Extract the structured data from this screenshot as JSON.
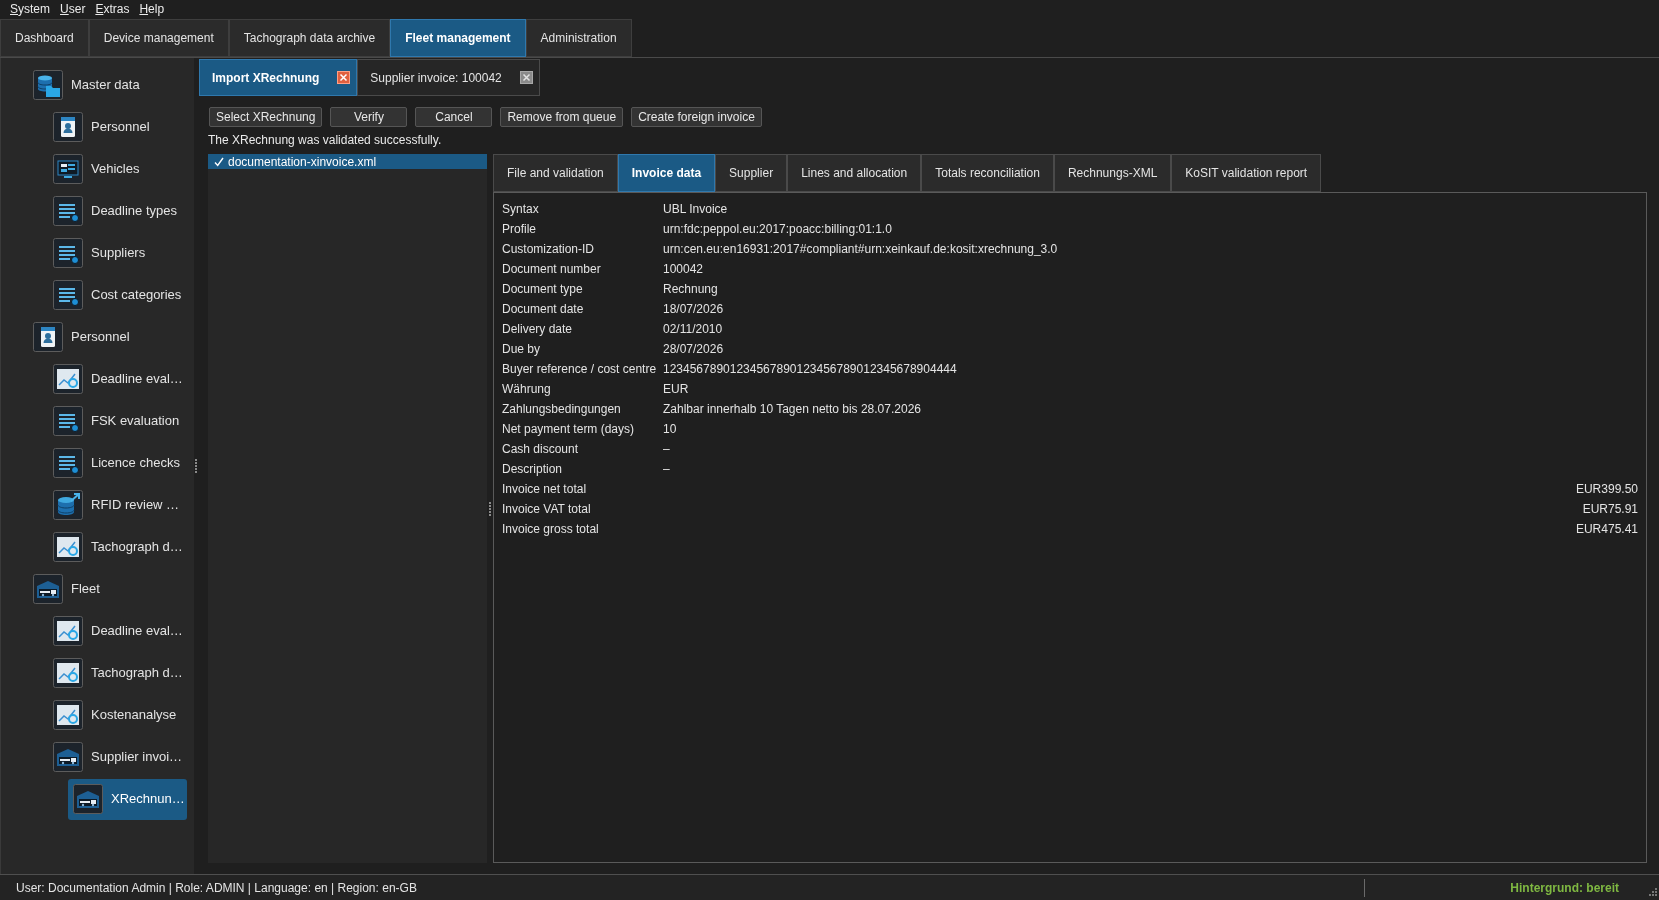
{
  "menu_bar": [
    {
      "label": "System",
      "mnemonic": true
    },
    {
      "label": "User",
      "mnemonic": true
    },
    {
      "label": "Extras",
      "mnemonic": true
    },
    {
      "label": "Help",
      "mnemonic": true
    }
  ],
  "main_tabs": [
    {
      "label": "Dashboard",
      "selected": false
    },
    {
      "label": "Device management",
      "selected": false
    },
    {
      "label": "Tachograph data archive",
      "selected": false
    },
    {
      "label": "Fleet management",
      "selected": true
    },
    {
      "label": "Administration",
      "selected": false
    }
  ],
  "sidebar": {
    "items": [
      {
        "label": "Master data",
        "kind": "database",
        "selected": false,
        "children": [
          {
            "label": "Personnel",
            "kind": "badge",
            "selected": false
          },
          {
            "label": "Vehicles",
            "kind": "panels",
            "selected": false
          },
          {
            "label": "Deadline types",
            "kind": "list",
            "selected": false
          },
          {
            "label": "Suppliers",
            "kind": "list",
            "selected": false
          },
          {
            "label": "Cost categories",
            "kind": "list",
            "selected": false
          }
        ]
      },
      {
        "label": "Personnel",
        "kind": "badge",
        "selected": false,
        "children": [
          {
            "label": "Deadline eval…",
            "kind": "chart",
            "selected": false
          },
          {
            "label": "FSK evaluation",
            "kind": "list",
            "selected": false
          },
          {
            "label": "Licence checks",
            "kind": "list",
            "selected": false
          },
          {
            "label": "RFID review …",
            "kind": "transfer",
            "selected": false
          },
          {
            "label": "Tachograph d…",
            "kind": "chart",
            "selected": false
          }
        ]
      },
      {
        "label": "Fleet",
        "kind": "truck",
        "selected": false,
        "children": [
          {
            "label": "Deadline eval…",
            "kind": "chart",
            "selected": false
          },
          {
            "label": "Tachograph d…",
            "kind": "chart",
            "selected": false
          },
          {
            "label": "Kostenanalyse",
            "kind": "chart",
            "selected": false
          },
          {
            "label": "Supplier invoi…",
            "kind": "truck",
            "selected": false,
            "children": [
              {
                "label": "XRechnun…",
                "kind": "truck",
                "selected": true
              }
            ]
          }
        ]
      }
    ]
  },
  "document_tabs": [
    {
      "label": "Import XRechnung",
      "selected": true
    },
    {
      "label": "Supplier invoice: 100042",
      "selected": false
    }
  ],
  "toolbar": {
    "buttons": [
      "Select XRechnung",
      "Verify",
      "Cancel",
      "Remove from queue",
      "Create foreign invoice"
    ]
  },
  "message": "The XRechnung was validated successfully.",
  "file_list": [
    {
      "name": "documentation-xinvoice.xml",
      "checked": true,
      "selected": true
    }
  ],
  "detail_tabs": [
    {
      "label": "File and validation",
      "selected": false
    },
    {
      "label": "Invoice data",
      "selected": true
    },
    {
      "label": "Supplier",
      "selected": false
    },
    {
      "label": "Lines and allocation",
      "selected": false
    },
    {
      "label": "Totals reconciliation",
      "selected": false
    },
    {
      "label": "Rechnungs-XML",
      "selected": false
    },
    {
      "label": "KoSIT validation report",
      "selected": false
    }
  ],
  "invoice_data": {
    "rows": [
      {
        "label": "Syntax",
        "value": "UBL Invoice",
        "kind": "text"
      },
      {
        "label": "Profile",
        "value": "urn:fdc:peppol.eu:2017:poacc:billing:01:1.0",
        "kind": "text"
      },
      {
        "label": "Customization-ID",
        "value": "urn:cen.eu:en16931:2017#compliant#urn:xeinkauf.de:kosit:xrechnung_3.0",
        "kind": "text"
      },
      {
        "label": "Document number",
        "value": "100042",
        "kind": "text"
      },
      {
        "label": "Document type",
        "value": "Rechnung",
        "kind": "text"
      },
      {
        "label": "Document date",
        "value": "18/07/2026",
        "kind": "text"
      },
      {
        "label": "Delivery date",
        "value": "02/11/2010",
        "kind": "text"
      },
      {
        "label": "Due by",
        "value": "28/07/2026",
        "kind": "text"
      },
      {
        "label": "Buyer reference / cost centre",
        "value": "12345678901234567890123456789012345678904444",
        "kind": "text"
      },
      {
        "label": "Währung",
        "value": "EUR",
        "kind": "text"
      },
      {
        "label": "Zahlungsbedingungen",
        "value": "Zahlbar innerhalb 10 Tagen netto bis 28.07.2026",
        "kind": "text"
      },
      {
        "label": "Net payment term (days)",
        "value": "10",
        "kind": "text"
      },
      {
        "label": "Cash discount",
        "value": "–",
        "kind": "text"
      },
      {
        "label": "Description",
        "value": "–",
        "kind": "text"
      },
      {
        "label": "Invoice net total",
        "value": "EUR399.50",
        "kind": "amount"
      },
      {
        "label": "Invoice VAT total",
        "value": "EUR75.91",
        "kind": "amount"
      },
      {
        "label": "Invoice gross total",
        "value": "EUR475.41",
        "kind": "amount"
      }
    ]
  },
  "status_bar": {
    "text": "User: Documentation Admin | Role: ADMIN | Language: en | Region: en-GB",
    "background_status": "Hintergrund: bereit"
  }
}
